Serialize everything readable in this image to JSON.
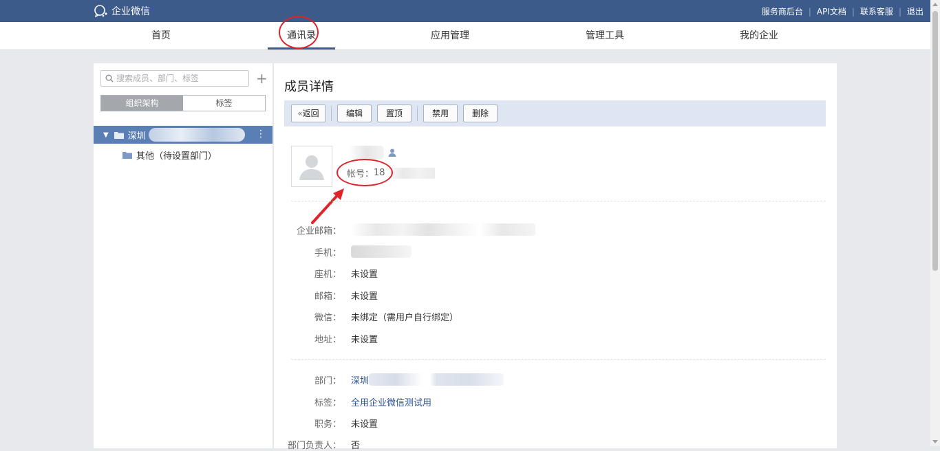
{
  "topbar": {
    "logo_text": "企业微信",
    "links": [
      "服务商后台",
      "API文档",
      "联系客服",
      "退出"
    ]
  },
  "nav": {
    "items": [
      "首页",
      "通讯录",
      "应用管理",
      "管理工具",
      "我的企业"
    ],
    "active": "通讯录"
  },
  "sidebar": {
    "search_placeholder": "搜索成员、部门、标签",
    "tabs": [
      "组织架构",
      "标签"
    ],
    "active_tab": "组织架构",
    "tree": {
      "root_label": "深圳",
      "child_label": "其他（待设置部门）"
    }
  },
  "detail": {
    "title": "成员详情",
    "buttons": {
      "back": "返回",
      "edit": "编辑",
      "pin": "置顶",
      "disable": "禁用",
      "delete": "删除"
    },
    "account_label": "帐号：",
    "account_value_visible": "18",
    "fields": [
      {
        "label": "企业邮箱：",
        "value": ""
      },
      {
        "label": "手机：",
        "value": ""
      },
      {
        "label": "座机：",
        "value": "未设置"
      },
      {
        "label": "邮箱：",
        "value": "未设置"
      },
      {
        "label": "微信：",
        "value": "未绑定（需用户自行绑定）"
      },
      {
        "label": "地址：",
        "value": "未设置"
      }
    ],
    "fields2": [
      {
        "label": "部门：",
        "value": "深圳"
      },
      {
        "label": "标签：",
        "value": "全用企业微信测试用"
      },
      {
        "label": "职务：",
        "value": "未设置"
      },
      {
        "label": "部门负责人：",
        "value": "否"
      }
    ]
  },
  "colors": {
    "brand": "#3c5a8a",
    "highlight": "#e0242a",
    "link": "#2d5591"
  }
}
